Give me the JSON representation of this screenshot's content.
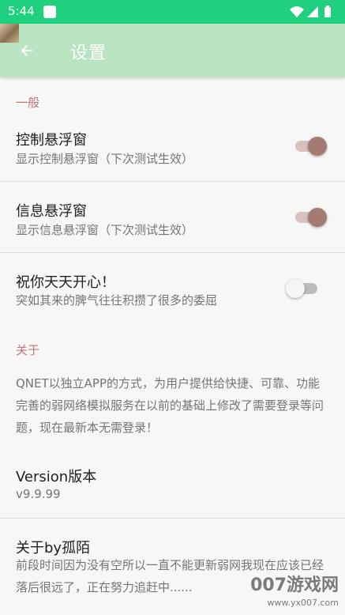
{
  "status_bar": {
    "time": "5:44"
  },
  "app_bar": {
    "title": "设置",
    "back_icon": "arrow-back-icon"
  },
  "sections": {
    "general": {
      "header": "一般",
      "items": [
        {
          "title": "控制悬浮窗",
          "summary": "显示控制悬浮窗（下次测试生效）",
          "checked": true
        },
        {
          "title": "信息悬浮窗",
          "summary": "显示信息悬浮窗（下次测试生效）",
          "checked": true
        },
        {
          "title": "祝你天天开心！",
          "summary": "突如其来的脾气往往积攒了很多的委屈",
          "checked": false
        }
      ]
    },
    "about": {
      "header": "关于",
      "description": "QNET以独立APP的方式，为用户提供给快捷、可靠、功能完善的弱网络模拟服务在以前的基础上修改了需要登录等问题，现在最新本无需登录！",
      "version_title": "Version版本",
      "version_value": "v9.9.99",
      "author_title": "关于by孤陌",
      "author_summary": "前段时间因为没有空所以一直不能更新弱网我现在应该已经落后很远了，正在努力追赶中......"
    }
  },
  "watermark": {
    "main": "007游戏网",
    "sub": "www.yx007.com"
  },
  "colors": {
    "status_bar": "#1fd07e",
    "app_bar": "#b8e4c0",
    "section_header": "#c0787a",
    "switch_thumb_on": "#a37b73",
    "switch_track_on": "#d7c2bf"
  }
}
